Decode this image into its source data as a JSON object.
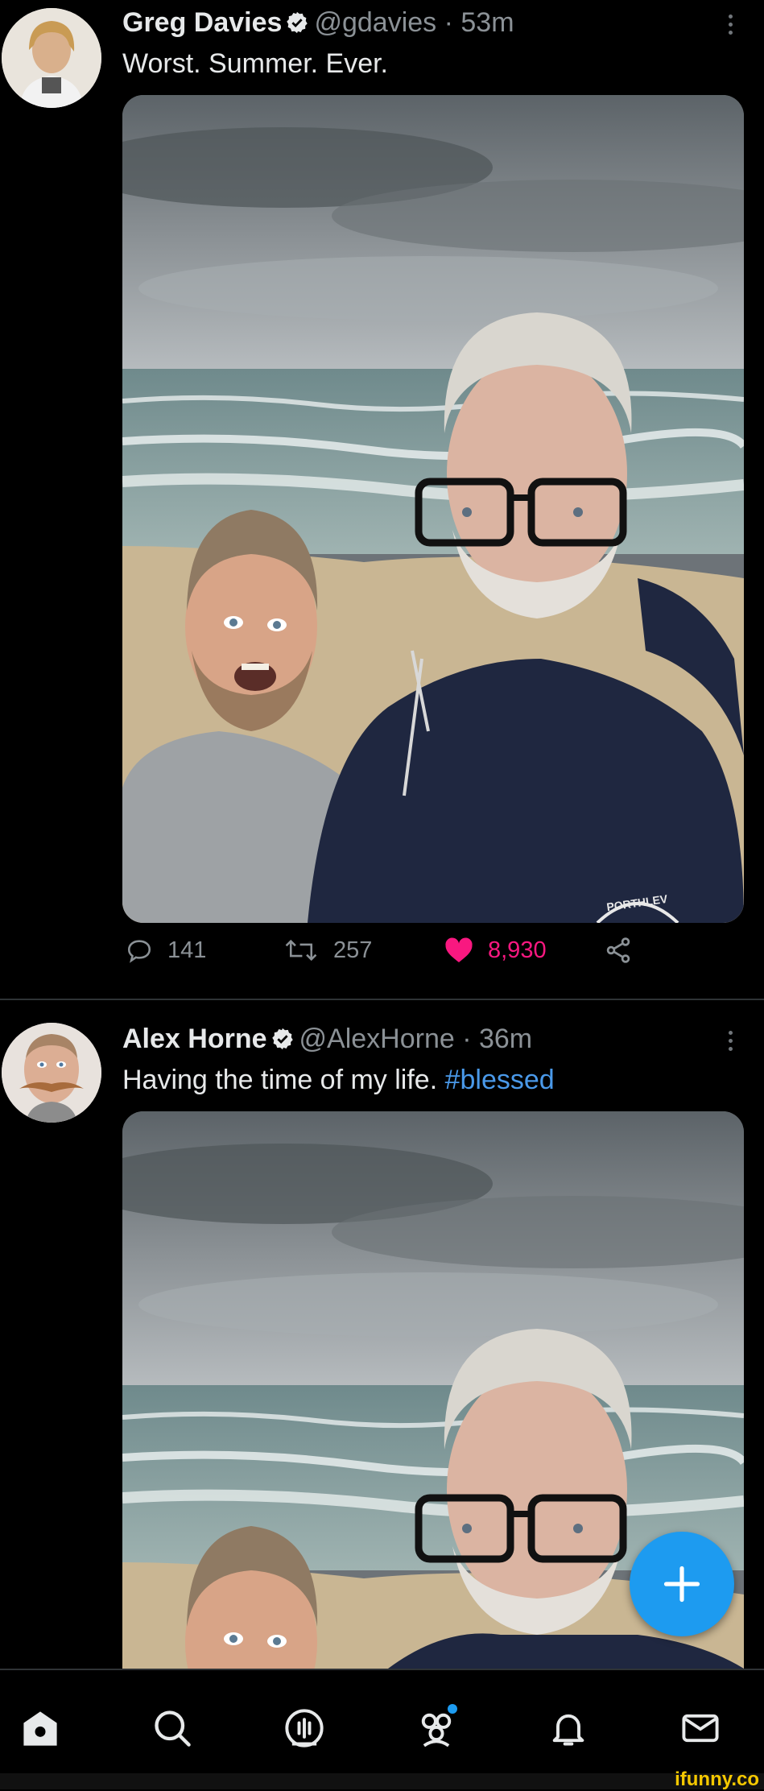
{
  "tweets": [
    {
      "name": "Greg Davies",
      "handle": "@gdavies",
      "time": "· 53m",
      "text": "Worst. Summer. Ever.",
      "stats": {
        "replies": "141",
        "retweets": "257",
        "likes": "8,930"
      }
    },
    {
      "name": "Alex Horne",
      "handle": "@AlexHorne",
      "time": "· 36m",
      "text": "Having the time of my life.",
      "hashtag": "#blessed"
    }
  ],
  "photo_sweatshirt_text": "PORTHLEV",
  "fab": {
    "icon": "plus-icon"
  },
  "nav": [
    "home-icon",
    "search-icon",
    "spaces-icon",
    "communities-icon",
    "notifications-icon",
    "messages-icon"
  ],
  "watermark": "ifunny.co",
  "colors": {
    "accent": "#1d9bf0",
    "like": "#f91880",
    "hashtag": "#4a99e9",
    "muted": "#8b9196"
  }
}
